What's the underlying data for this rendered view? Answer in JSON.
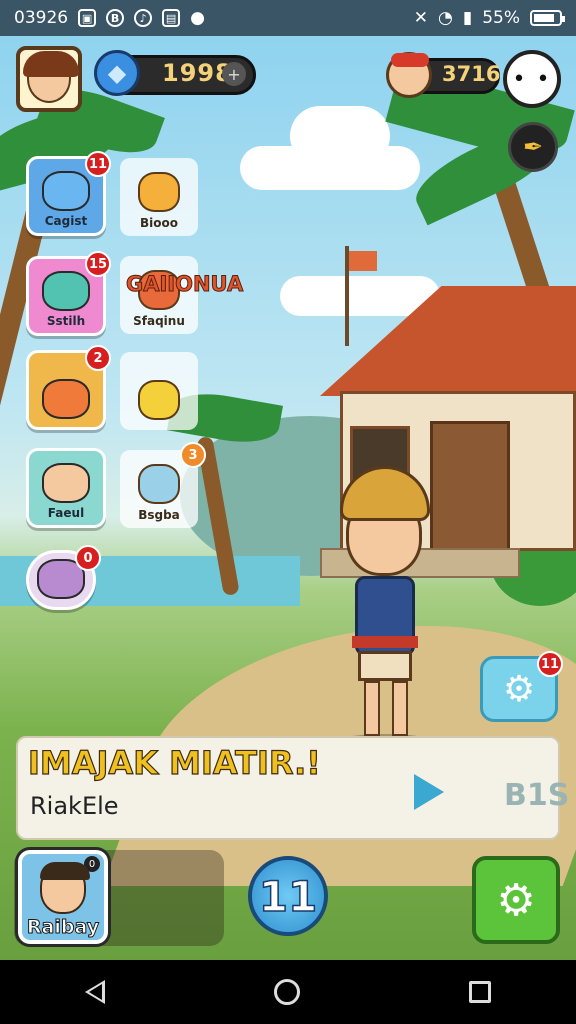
{
  "status_bar": {
    "time": "03926",
    "icons": [
      "photo-icon",
      "b-icon",
      "audio-icon",
      "image-icon",
      "dot-icon"
    ],
    "right_icons": [
      "mute-icon",
      "wifi-icon",
      "signal-icon"
    ],
    "battery": "55%"
  },
  "hud": {
    "gems": "1998",
    "gem_plus": "+",
    "coins": "3716",
    "ghost_glyph": "• •",
    "feather_glyph": "✒"
  },
  "menu": {
    "tiles": [
      {
        "label": "Cagist",
        "badge": "11",
        "color": "#5fa8e8",
        "art": "#6ab6f0"
      },
      {
        "label": "Sstilh",
        "badge": "15",
        "color": "#f08ad0",
        "art": "#52c3b0"
      },
      {
        "label": "",
        "badge": "2",
        "color": "#f0b84a",
        "art": "#f07a3a"
      },
      {
        "label": "Faeul",
        "badge": "",
        "color": "#8ad8d0",
        "art": "#f5c9a0"
      },
      {
        "label": "",
        "badge": "0",
        "color": "#e8d8f0",
        "art": "#b88ad0"
      }
    ],
    "cards": [
      {
        "label": "Biooo",
        "badge": "",
        "art": "#f4b03a"
      },
      {
        "label": "Sfaqinu",
        "badge": "",
        "art": "#e86a3a"
      },
      {
        "label": "",
        "badge": "",
        "art": "#f4d03a"
      },
      {
        "label": "Bsgba",
        "badge": "3",
        "art": "#9ad0e8"
      }
    ],
    "promo_title": "GAIIONUA"
  },
  "float_gear_badge": "11",
  "dialog": {
    "title": "IMAJAK MIATIR.!",
    "subtitle": "RiakEle",
    "count": "B1S"
  },
  "bottom": {
    "character_label": "Raibay",
    "character_mini": "0",
    "level": "11",
    "gear_glyph": "⚙"
  }
}
